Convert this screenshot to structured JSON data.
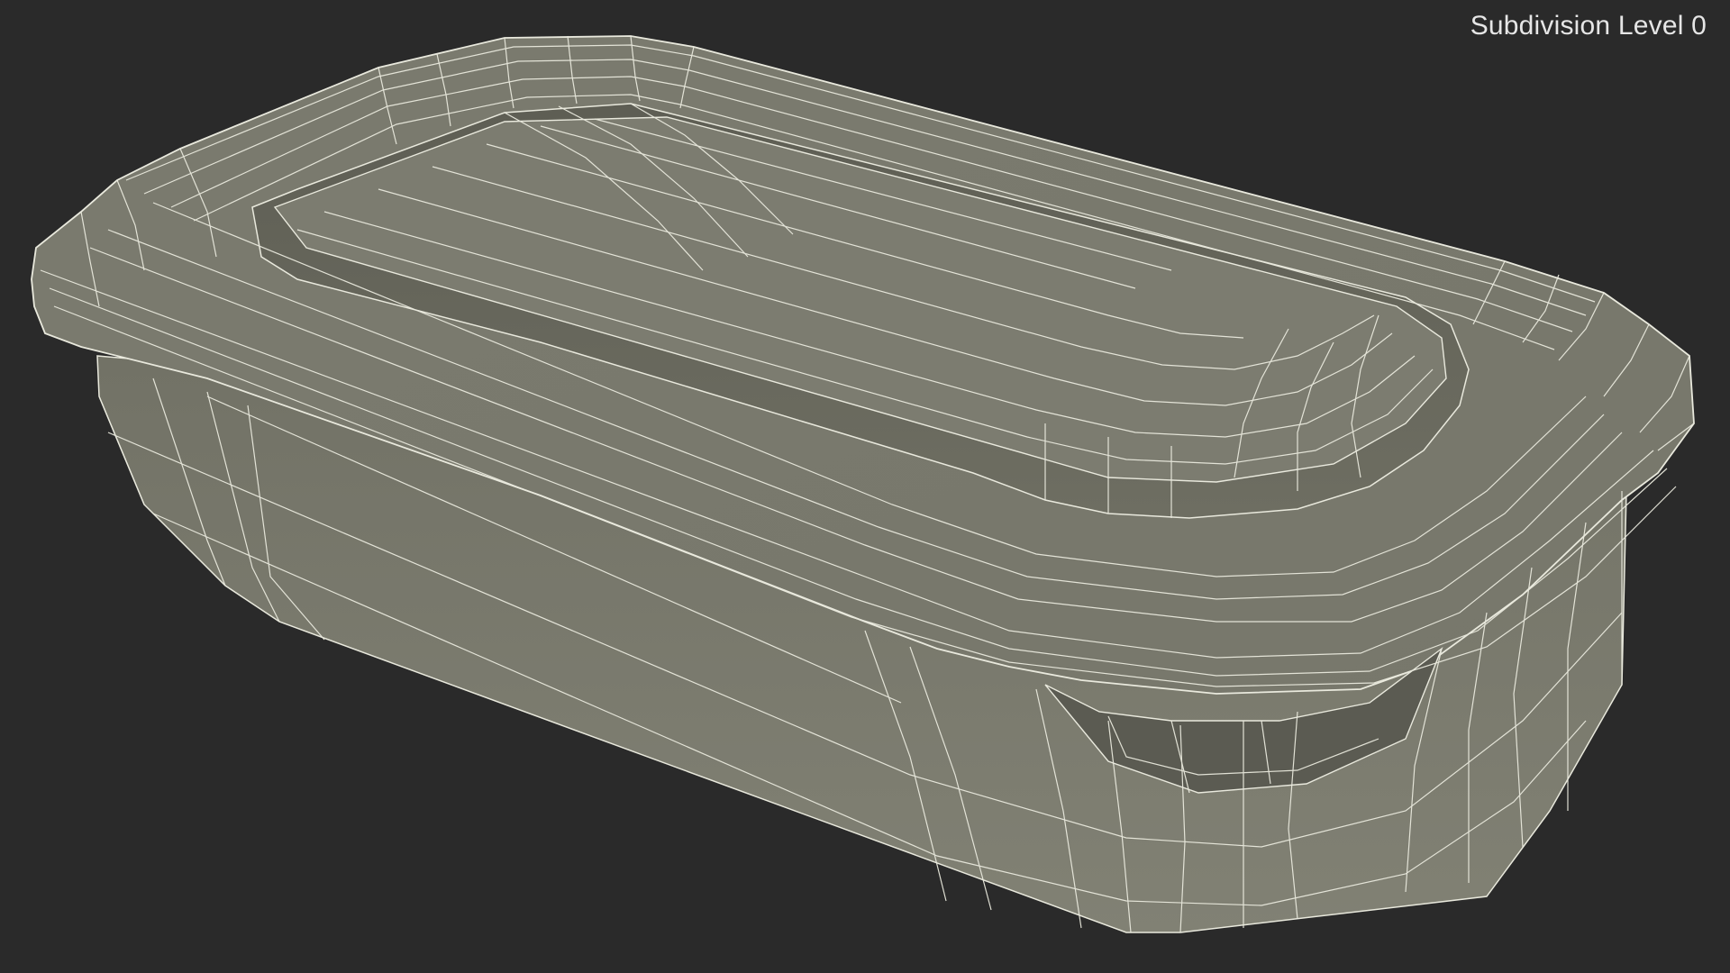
{
  "render": {
    "label": "Subdivision Level 0"
  },
  "colors": {
    "background": "#2a2a2a",
    "surface": "#7a7a6e",
    "wire": "#e9e9dd"
  }
}
